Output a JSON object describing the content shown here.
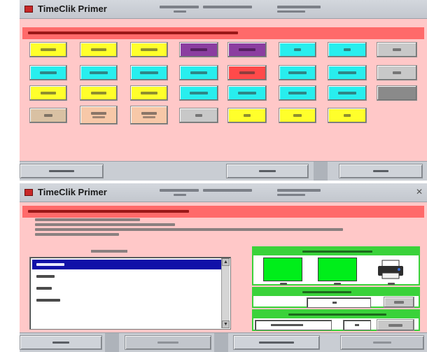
{
  "top_window": {
    "app_title": "TimeClik Primer"
  },
  "bottom_window": {
    "app_title": "TimeClik Primer"
  },
  "colors": {
    "window_bg": "#ffc8c8",
    "banner": "#ff6a6a",
    "yellow_button": "#ffff2b",
    "cyan_button": "#28eeee",
    "purple_button": "#8b3ea0",
    "red_button": "#ff4a4a",
    "grey_button": "#c8c8c8",
    "green_panel": "#3ad23a",
    "green_swatch": "#00ee1a",
    "list_selection": "#1010a8"
  },
  "icons": {
    "app_icon": "app-icon",
    "printer_icon": "printer-icon",
    "close_icon": "close-icon"
  }
}
